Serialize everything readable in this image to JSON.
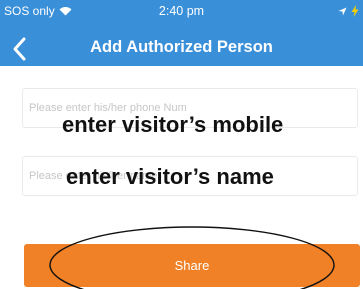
{
  "status_bar": {
    "carrier": "SOS only",
    "time": "2:40 pm",
    "icons": [
      "wifi-icon",
      "location-arrow-icon",
      "battery-charging-icon"
    ]
  },
  "header": {
    "title": "Add Authorized Person",
    "back_icon": "chevron-left-icon"
  },
  "form": {
    "mobile_field": {
      "placeholder": "Please enter his/her phone Num",
      "value": ""
    },
    "name_field": {
      "placeholder": "Please enter his/her name",
      "value": ""
    },
    "share_label": "Share"
  },
  "annotations": {
    "mobile": "enter visitor’s mobile",
    "name": "enter visitor’s name"
  },
  "colors": {
    "header": "#3a8fd9",
    "share_button": "#f08126",
    "annotation_ellipse": "#111111"
  }
}
